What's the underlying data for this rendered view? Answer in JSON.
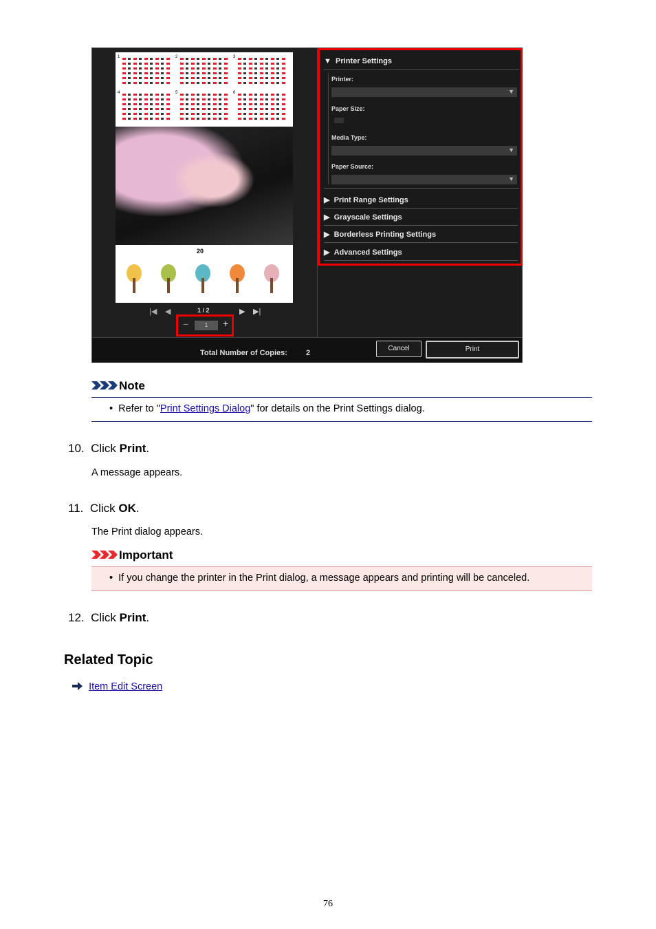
{
  "screenshot": {
    "calendar_months": [
      "1",
      "2",
      "3",
      "4",
      "5",
      "6"
    ],
    "year_label": "20",
    "page_indicator": "1 / 2",
    "copies_value": "1",
    "minus_label": "−",
    "plus_label": "+",
    "printer_settings_title": "Printer Settings",
    "printer_label": "Printer:",
    "paper_size_label": "Paper Size:",
    "media_type_label": "Media Type:",
    "paper_source_label": "Paper Source:",
    "sections": [
      "Print Range Settings",
      "Grayscale Settings",
      "Borderless Printing Settings",
      "Advanced Settings"
    ],
    "total_copies_label": "Total Number of Copies:",
    "total_copies_value": "2",
    "cancel_label": "Cancel",
    "print_label": "Print"
  },
  "note": {
    "heading": "Note",
    "bullet_prefix": "Refer to \"",
    "link_text": "Print Settings Dialog",
    "bullet_suffix": "\" for details on the Print Settings dialog."
  },
  "steps": [
    {
      "number": "10.",
      "pre": "Click ",
      "bold": "Print",
      "post": ".",
      "desc": "A message appears."
    },
    {
      "number": "11.",
      "pre": "Click ",
      "bold": "OK",
      "post": ".",
      "desc": "The Print dialog appears."
    },
    {
      "number": "12.",
      "pre": "Click ",
      "bold": "Print",
      "post": "."
    }
  ],
  "important": {
    "heading": "Important",
    "bullet": "If you change the printer in the Print dialog, a message appears and printing will be canceled."
  },
  "related": {
    "heading": "Related Topic",
    "link_text": "Item Edit Screen"
  },
  "page_number": "76",
  "colors": {
    "note_accent": "#1a3a7a",
    "important_accent": "#e8282a",
    "highlight_red": "#e00000"
  }
}
